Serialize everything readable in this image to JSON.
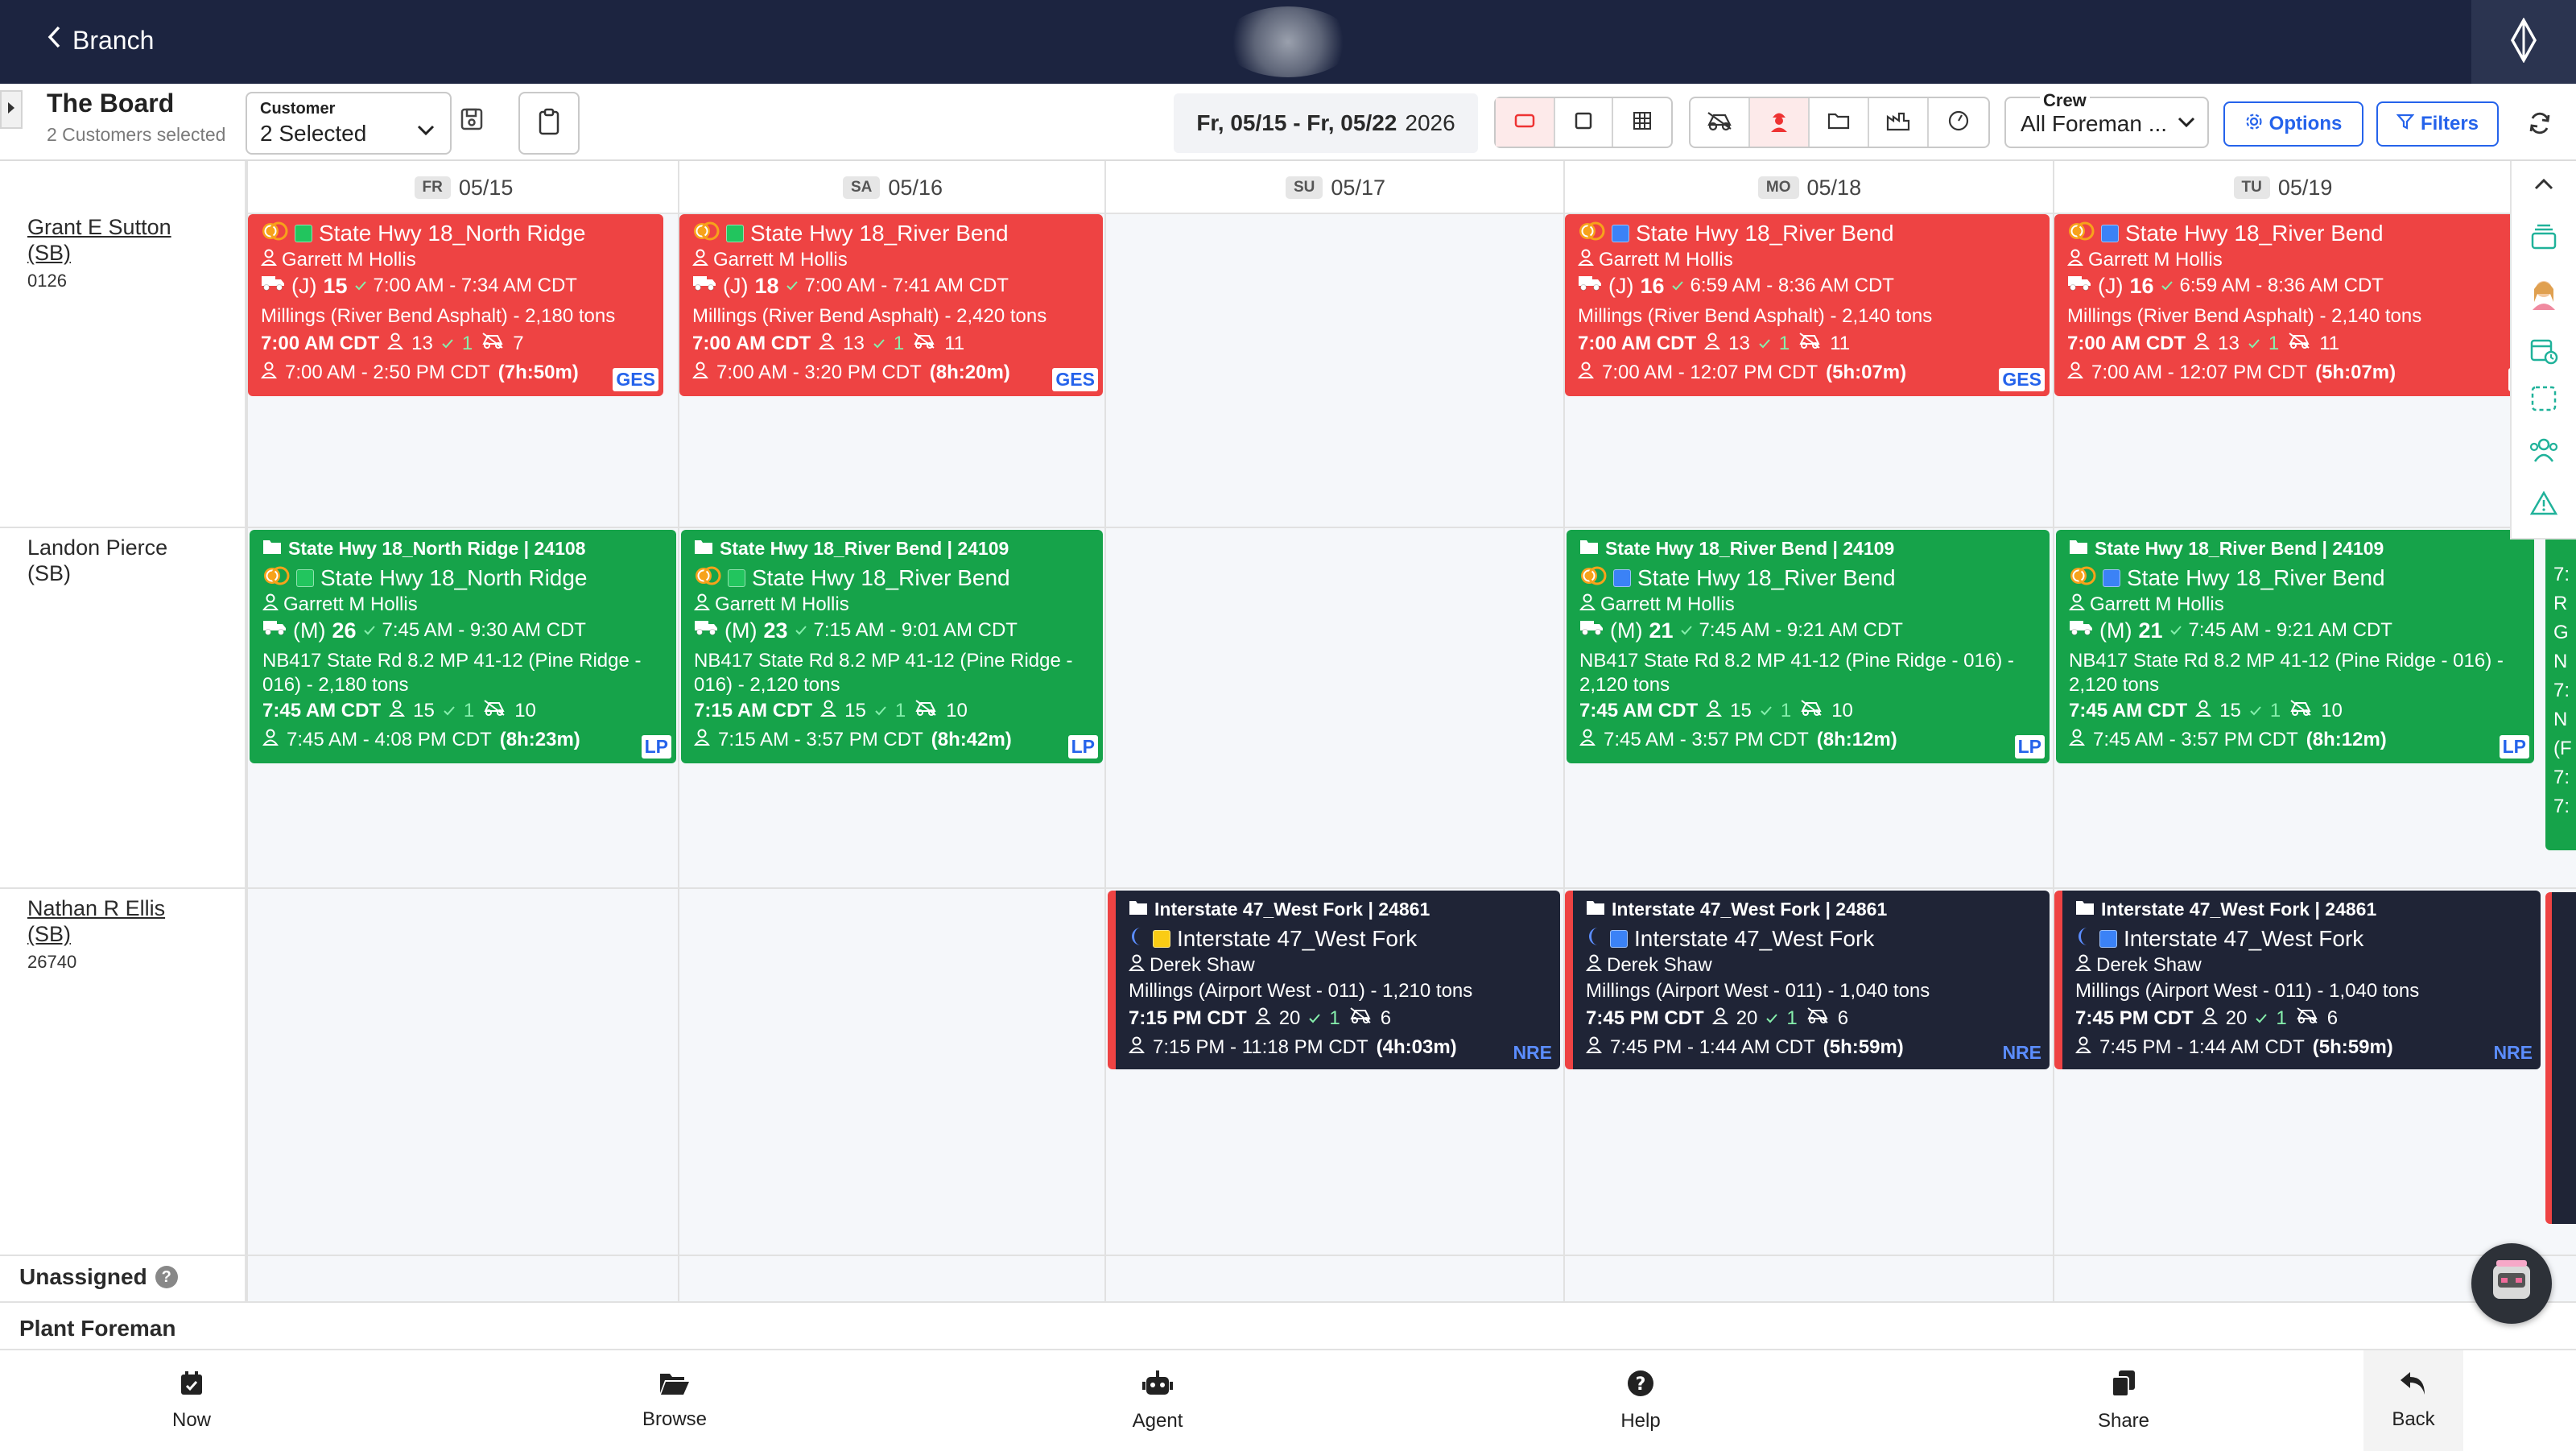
{
  "topbar": {
    "back_label": "Branch"
  },
  "toolbar": {
    "title": "The Board",
    "subtitle": "2 Customers selected",
    "customer_label": "Customer",
    "customer_value": "2 Selected",
    "date_range": "Fr, 05/15 - Fr, 05/22",
    "year": "2026",
    "crew_label": "Crew",
    "crew_value": "All Foreman ...",
    "options_label": "Options",
    "filters_label": "Filters"
  },
  "days": [
    {
      "abbr": "FR",
      "date": "05/15"
    },
    {
      "abbr": "SA",
      "date": "05/16"
    },
    {
      "abbr": "SU",
      "date": "05/17"
    },
    {
      "abbr": "MO",
      "date": "05/18"
    },
    {
      "abbr": "TU",
      "date": "05/19"
    }
  ],
  "rows": [
    {
      "name": "Grant E Sutton (SB)",
      "code": "0126"
    },
    {
      "name": "Landon Pierce (SB)",
      "code": ""
    },
    {
      "name": "Nathan R Ellis (SB)",
      "code": "26740"
    }
  ],
  "sections": {
    "unassigned": "Unassigned",
    "plant_foreman": "Plant Foreman"
  },
  "cards": [
    {
      "header": "",
      "job": "State Hwy 18_North Ridge",
      "foreman": "Garrett M Hollis",
      "truck_type": "(J)",
      "truck_count": "15",
      "truck_time": "7:00 AM - 7:34 AM CDT",
      "material": "Millings (River Bend Asphalt) - 2,180 tons",
      "start": "7:00 AM CDT",
      "crew": "13",
      "extra": "1",
      "equip": "7",
      "shift": "7:00 AM - 2:50 PM CDT",
      "duration": "(7h:50m)",
      "badge": "GES",
      "square": "#22c55e"
    },
    {
      "header": "",
      "job": "State Hwy 18_River Bend",
      "foreman": "Garrett M Hollis",
      "truck_type": "(J)",
      "truck_count": "18",
      "truck_time": "7:00 AM - 7:41 AM CDT",
      "material": "Millings (River Bend Asphalt) - 2,420 tons",
      "start": "7:00 AM CDT",
      "crew": "13",
      "extra": "1",
      "equip": "11",
      "shift": "7:00 AM - 3:20 PM CDT",
      "duration": "(8h:20m)",
      "badge": "GES",
      "square": "#22c55e"
    },
    {
      "header": "",
      "job": "State Hwy 18_River Bend",
      "foreman": "Garrett M Hollis",
      "truck_type": "(J)",
      "truck_count": "16",
      "truck_time": "6:59 AM - 8:36 AM CDT",
      "material": "Millings (River Bend Asphalt) - 2,140 tons",
      "start": "7:00 AM CDT",
      "crew": "13",
      "extra": "1",
      "equip": "11",
      "shift": "7:00 AM - 12:07 PM CDT",
      "duration": "(5h:07m)",
      "badge": "GES",
      "square": "#3b82f6"
    },
    {
      "header": "",
      "job": "State Hwy 18_River Bend",
      "foreman": "Garrett M Hollis",
      "truck_type": "(J)",
      "truck_count": "16",
      "truck_time": "6:59 AM - 8:36 AM CDT",
      "material": "Millings (River Bend Asphalt) - 2,140 tons",
      "start": "7:00 AM CDT",
      "crew": "13",
      "extra": "1",
      "equip": "11",
      "shift": "7:00 AM - 12:07 PM CDT",
      "duration": "(5h:07m)",
      "badge": "G",
      "square": "#3b82f6"
    },
    {
      "header": "State Hwy 18_North Ridge | 24108",
      "job": "State Hwy 18_North Ridge",
      "foreman": "Garrett M Hollis",
      "truck_type": "(M)",
      "truck_count": "26",
      "truck_time": "7:45 AM - 9:30 AM CDT",
      "material": "NB417 State Rd 8.2 MP 41-12 (Pine Ridge -",
      "material2": "016) - 2,180 tons",
      "start": "7:45 AM CDT",
      "crew": "15",
      "extra": "1",
      "equip": "10",
      "shift": "7:45 AM - 4:08 PM CDT",
      "duration": "(8h:23m)",
      "badge": "LP",
      "square": "#22c55e"
    },
    {
      "header": "State Hwy 18_River Bend | 24109",
      "job": "State Hwy 18_River Bend",
      "foreman": "Garrett M Hollis",
      "truck_type": "(M)",
      "truck_count": "23",
      "truck_time": "7:15 AM - 9:01 AM CDT",
      "material": "NB417 State Rd 8.2 MP 41-12 (Pine Ridge -",
      "material2": "016) - 2,120 tons",
      "start": "7:15 AM CDT",
      "crew": "15",
      "extra": "1",
      "equip": "10",
      "shift": "7:15 AM - 3:57 PM CDT",
      "duration": "(8h:42m)",
      "badge": "LP",
      "square": "#22c55e"
    },
    {
      "header": "State Hwy 18_River Bend | 24109",
      "job": "State Hwy 18_River Bend",
      "foreman": "Garrett M Hollis",
      "truck_type": "(M)",
      "truck_count": "21",
      "truck_time": "7:45 AM - 9:21 AM CDT",
      "material": "NB417 State Rd 8.2 MP 41-12 (Pine Ridge - 016) -",
      "material2": "2,120 tons",
      "start": "7:45 AM CDT",
      "crew": "15",
      "extra": "1",
      "equip": "10",
      "shift": "7:45 AM - 3:57 PM CDT",
      "duration": "(8h:12m)",
      "badge": "LP",
      "square": "#3b82f6"
    },
    {
      "header": "State Hwy 18_River Bend | 24109",
      "job": "State Hwy 18_River Bend",
      "foreman": "Garrett M Hollis",
      "truck_type": "(M)",
      "truck_count": "21",
      "truck_time": "7:45 AM - 9:21 AM CDT",
      "material": "NB417 State Rd 8.2 MP 41-12 (Pine Ridge - 016) -",
      "material2": "2,120 tons",
      "start": "7:45 AM CDT",
      "crew": "15",
      "extra": "1",
      "equip": "10",
      "shift": "7:45 AM - 3:57 PM CDT",
      "duration": "(8h:12m)",
      "badge": "LP",
      "square": "#3b82f6"
    },
    {
      "header": "Interstate 47_West Fork | 24861",
      "job": "Interstate 47_West Fork",
      "foreman": "Derek Shaw",
      "material": "Millings (Airport West - 011) - 1,210 tons",
      "start": "7:15 PM CDT",
      "crew": "20",
      "extra": "1",
      "equip": "6",
      "shift": "7:15 PM - 11:18 PM CDT",
      "duration": "(4h:03m)",
      "badge": "NRE",
      "square": "#facc15"
    },
    {
      "header": "Interstate 47_West Fork | 24861",
      "job": "Interstate 47_West Fork",
      "foreman": "Derek Shaw",
      "material": "Millings (Airport West - 011) - 1,040 tons",
      "start": "7:45 PM CDT",
      "crew": "20",
      "extra": "1",
      "equip": "6",
      "shift": "7:45 PM - 1:44 AM CDT",
      "duration": "(5h:59m)",
      "badge": "NRE",
      "square": "#3b82f6"
    },
    {
      "header": "Interstate 47_West Fork | 24861",
      "job": "Interstate 47_West Fork",
      "foreman": "Derek Shaw",
      "material": "Millings (Airport West - 011) - 1,040 tons",
      "start": "7:45 PM CDT",
      "crew": "20",
      "extra": "1",
      "equip": "6",
      "shift": "7:45 PM - 1:44 AM CDT",
      "duration": "(5h:59m)",
      "badge": "NRE",
      "square": "#3b82f6"
    }
  ],
  "peek": {
    "lines": [
      "7:",
      "R",
      "G",
      "N",
      "7:",
      "N",
      "(F",
      "7:",
      "7:"
    ]
  },
  "bottom_nav": [
    {
      "label": "Now",
      "icon": "calendar-icon"
    },
    {
      "label": "Browse",
      "icon": "folder-open-icon"
    },
    {
      "label": "Agent",
      "icon": "robot-icon"
    },
    {
      "label": "Help",
      "icon": "help-icon"
    },
    {
      "label": "Share",
      "icon": "copy-icon"
    },
    {
      "label": "Back",
      "icon": "undo-icon"
    }
  ],
  "colors": {
    "navy": "#1c2440",
    "red": "#ee4343",
    "green": "#16a34a",
    "dark": "#1f2436",
    "accent": "#2563eb"
  }
}
